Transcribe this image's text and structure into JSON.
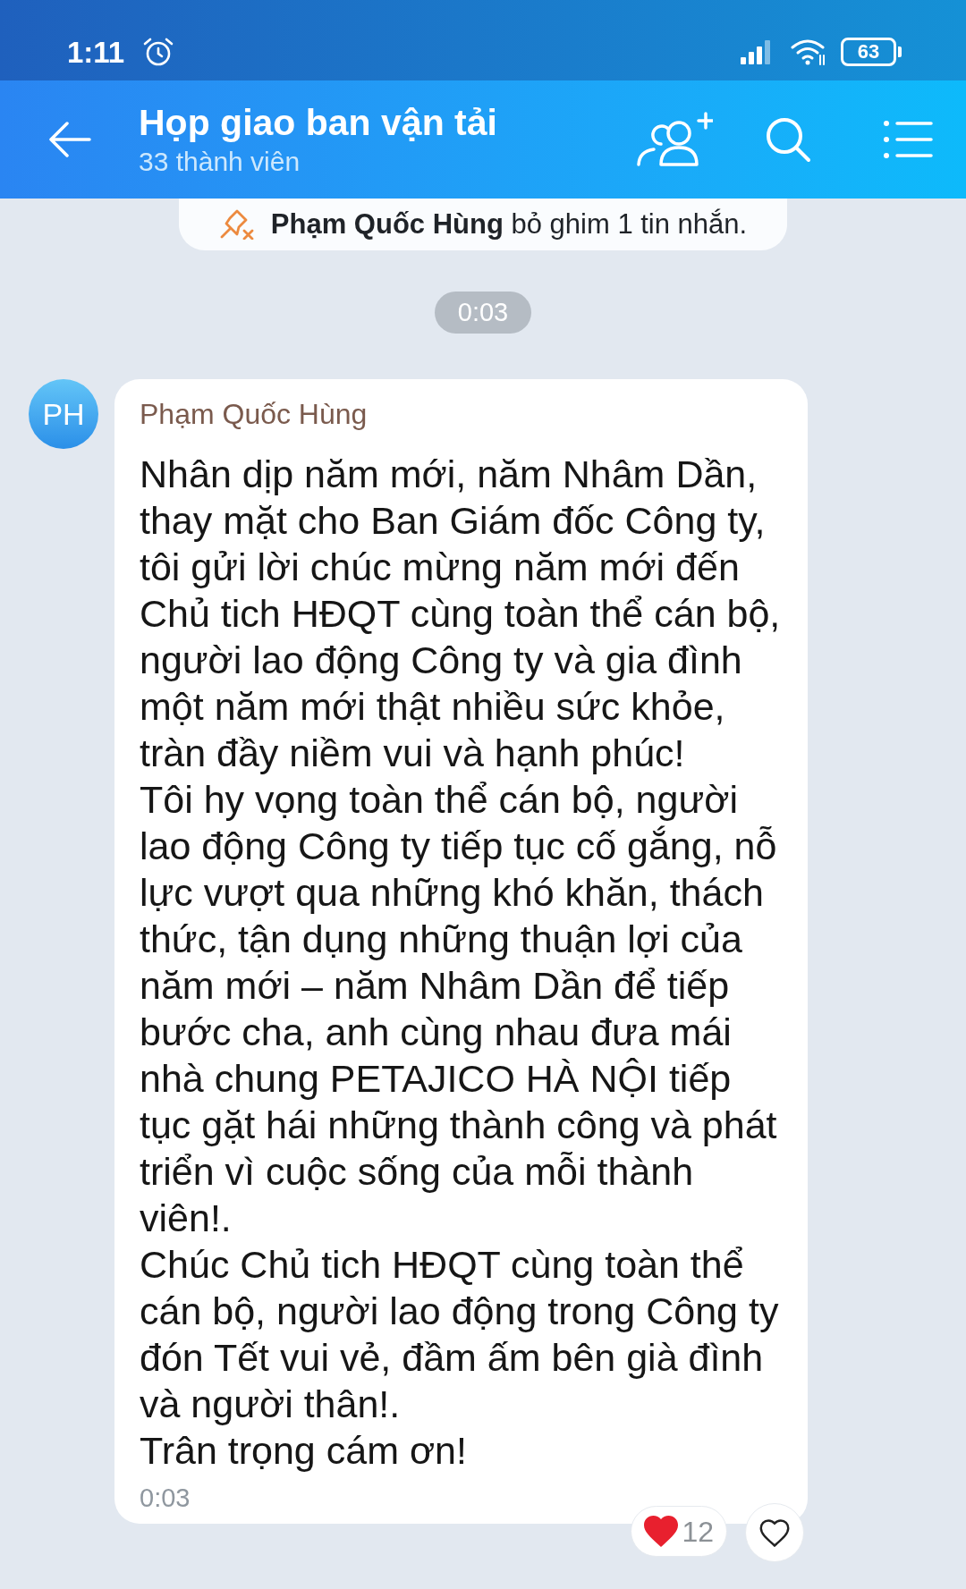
{
  "status_bar": {
    "time": "1:11",
    "battery": "63"
  },
  "header": {
    "title": "Họp giao ban vận tải",
    "subtitle": "33 thành viên"
  },
  "pinned_notice": "**Phạm Quốc Hùng** bỏ ghim 1 tin nhắn.",
  "time_divider": "0:03",
  "message": {
    "avatar": "PH",
    "sender": "Phạm Quốc Hùng",
    "paragraphs": [
      "Nhân dịp năm mới, năm Nhâm Dần, thay mặt cho Ban Giám đốc Công ty, tôi gửi lời chúc mừng năm mới đến Chủ tich HĐQT cùng toàn thể cán bộ, người lao động Công ty và gia đình một năm mới thật nhiều sức khỏe, tràn đầy niềm vui và hạnh phúc!",
      "Tôi hy vọng toàn thể cán bộ, người lao động Công ty tiếp tục cố gắng, nỗ lực vượt qua những khó khăn, thách thức, tận dụng những thuận lợi của năm mới – năm Nhâm Dần để tiếp bước cha, anh cùng nhau đưa mái nhà chung PETAJICO HÀ NỘI tiếp tục gặt hái những thành công và phát triển vì cuộc sống của mỗi thành viên!.",
      "Chúc Chủ tich HĐQT cùng toàn thể cán bộ, người lao động trong Công ty đón Tết vui vẻ, đầm ấm bên già đình và người thân!.",
      "Trân trọng cám ơn!"
    ],
    "time": "0:03",
    "reaction_count": "12",
    "liked": false
  }
}
